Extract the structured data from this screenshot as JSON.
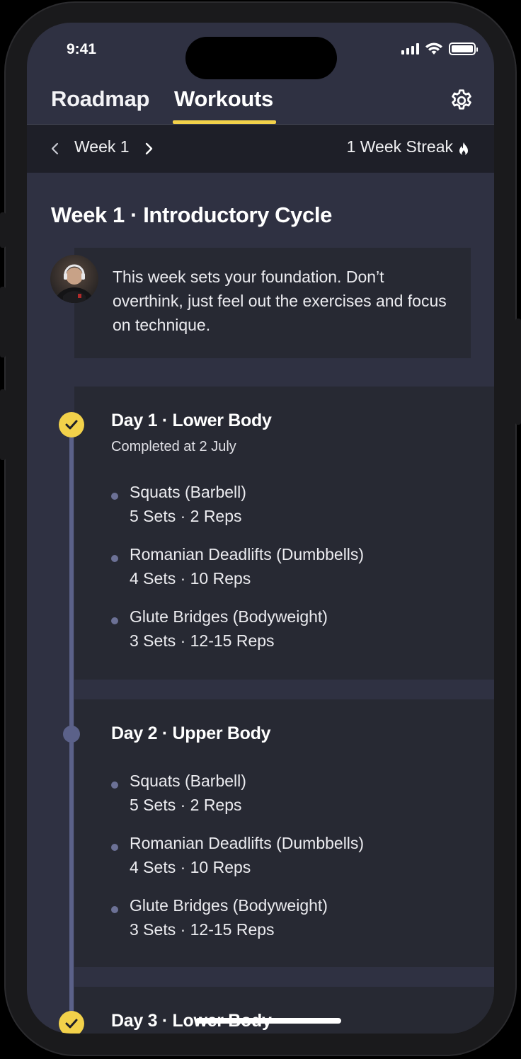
{
  "status_bar": {
    "time": "9:41"
  },
  "tabs": [
    {
      "label": "Roadmap",
      "active": false
    },
    {
      "label": "Workouts",
      "active": true
    }
  ],
  "colors": {
    "accent": "#f2d14a",
    "background": "#2f3142",
    "card": "#272933",
    "timeline": "#5b6189"
  },
  "week_nav": {
    "week_label": "Week 1",
    "streak_label": "1 Week Streak"
  },
  "week": {
    "title": "Week 1 · Introductory Cycle",
    "coach_message": "This week sets your foundation. Don’t overthink, just feel out the exercises and focus on technique."
  },
  "days": [
    {
      "title": "Day 1 · Lower Body",
      "subtitle": "Completed at 2 July",
      "completed": true,
      "exercises": [
        {
          "name": "Squats (Barbell)",
          "detail": "5 Sets · 2 Reps"
        },
        {
          "name": "Romanian Deadlifts (Dumbbells)",
          "detail": "4 Sets · 10 Reps"
        },
        {
          "name": "Glute Bridges (Bodyweight)",
          "detail": "3 Sets · 12-15 Reps"
        }
      ]
    },
    {
      "title": "Day 2 · Upper Body",
      "completed": false,
      "exercises": [
        {
          "name": "Squats (Barbell)",
          "detail": "5 Sets · 2 Reps"
        },
        {
          "name": "Romanian Deadlifts (Dumbbells)",
          "detail": "4 Sets · 10 Reps"
        },
        {
          "name": "Glute Bridges (Bodyweight)",
          "detail": "3 Sets · 12-15 Reps"
        }
      ]
    },
    {
      "title": "Day 3 · Lower Body",
      "completed": true
    }
  ],
  "icons": [
    "settings-gear-icon",
    "chevron-left-icon",
    "chevron-right-icon",
    "flame-icon",
    "checkmark-icon"
  ]
}
